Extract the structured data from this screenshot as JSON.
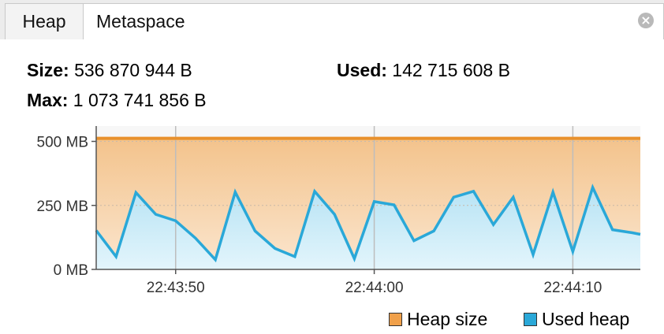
{
  "tabs": [
    {
      "label": "Heap",
      "active": true
    },
    {
      "label": "Metaspace",
      "active": false
    }
  ],
  "close_icon": "close-circle-icon",
  "stats": {
    "size_label": "Size:",
    "size_value": "536 870 944 B",
    "used_label": "Used:",
    "used_value": "142 715 608 B",
    "max_label": "Max:",
    "max_value": "1 073 741 856 B"
  },
  "colors": {
    "heap_size": "#e8912d",
    "used_heap": "#2aa8d8"
  },
  "chart_data": {
    "type": "area",
    "ylim": [
      0,
      560
    ],
    "yticks": [
      {
        "value": 0,
        "label": "0 MB"
      },
      {
        "value": 250,
        "label": "250 MB"
      },
      {
        "value": 500,
        "label": "500 MB"
      }
    ],
    "xticks": [
      {
        "value": 4,
        "label": "22:43:50"
      },
      {
        "value": 14,
        "label": "22:44:00"
      },
      {
        "value": 24,
        "label": "22:44:10"
      }
    ],
    "xlim": [
      0,
      27.4
    ],
    "x": [
      0,
      1,
      2,
      3,
      4,
      5,
      6,
      7,
      8,
      9,
      10,
      11,
      12,
      13,
      14,
      15,
      16,
      17,
      18,
      19,
      20,
      21,
      22,
      23,
      24,
      25,
      26,
      27,
      27.4
    ],
    "series": [
      {
        "name": "Heap size",
        "values": [
          512,
          512,
          512,
          512,
          512,
          512,
          512,
          512,
          512,
          512,
          512,
          512,
          512,
          512,
          512,
          512,
          512,
          512,
          512,
          512,
          512,
          512,
          512,
          512,
          512,
          512,
          512,
          512,
          512
        ]
      },
      {
        "name": "Used heap",
        "values": [
          152,
          50,
          300,
          215,
          190,
          122,
          38,
          302,
          150,
          82,
          50,
          305,
          215,
          42,
          265,
          252,
          112,
          150,
          282,
          305,
          175,
          282,
          58,
          302,
          70,
          320,
          155,
          143,
          137
        ]
      }
    ],
    "grid": true,
    "legend": "bottom-right"
  }
}
